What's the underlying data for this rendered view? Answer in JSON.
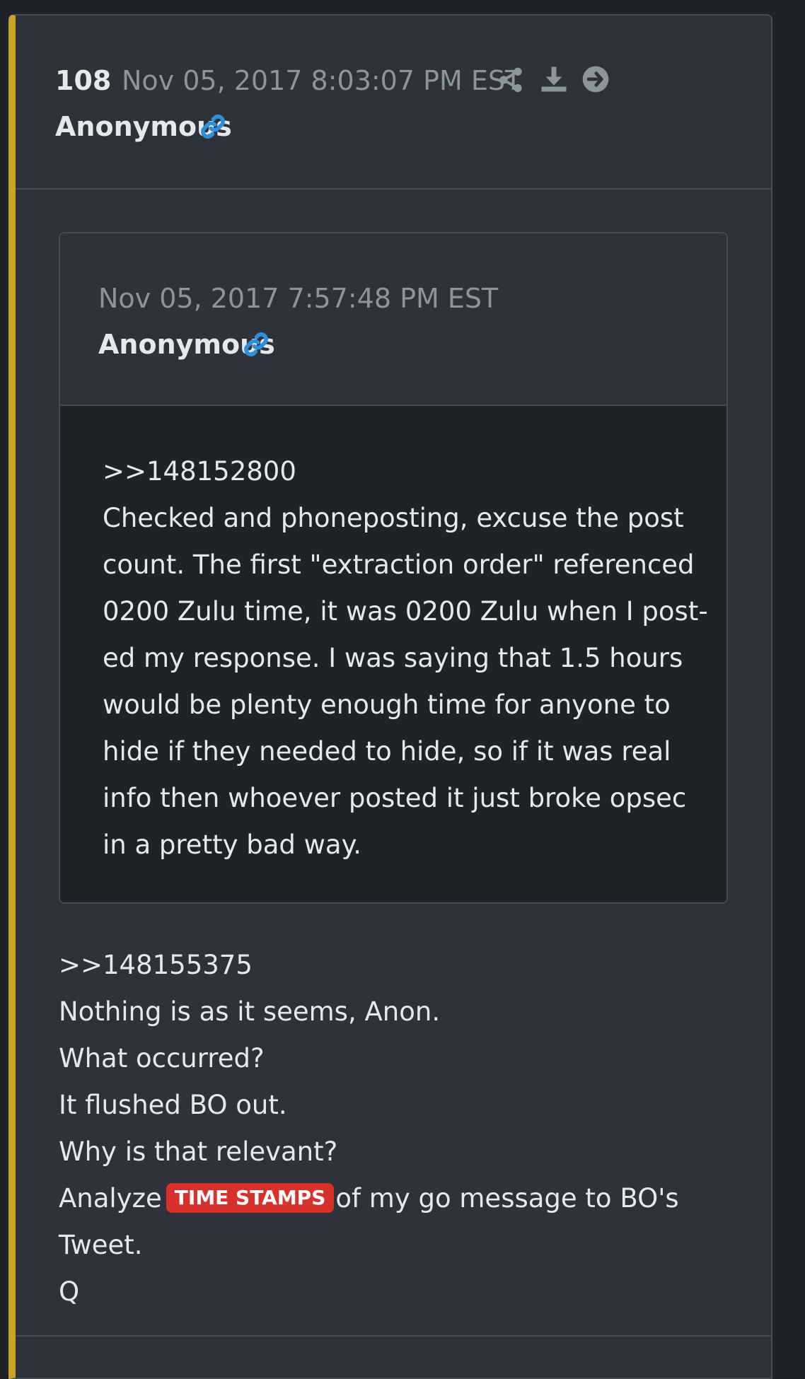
{
  "post": {
    "number": "108",
    "date": "Nov 05, 2017 8:03:07 PM EST",
    "author": "Anonymous",
    "actions": [
      "share-icon",
      "download-icon",
      "arrow-right-circle-icon"
    ]
  },
  "quoted_post": {
    "date": "Nov 05, 2017 7:57:48 PM EST",
    "author": "Anonymous",
    "lines": [
      ">>148152800",
      "Checked and phoneposting, excuse the post",
      "count. The first \"extraction order\" referenced",
      "0200 Zulu time, it was 0200 Zulu when I post-",
      "ed my response. I was saying that 1.5 hours",
      "would be plenty enough time for anyone to",
      "hide if they needed to hide, so if it was real",
      "info then whoever posted it just broke opsec",
      "in a pretty bad way."
    ]
  },
  "message": {
    "lines": [
      ">>148155375",
      "Nothing is as it seems, Anon.",
      "What occurred?",
      "It flushed BO out.",
      "Why is that relevant?"
    ],
    "highlight_line": {
      "before": "Analyze",
      "badge": "TIME STAMPS",
      "after": "of my go message to BO's"
    },
    "tail_lines": [
      "Tweet.",
      "Q"
    ]
  },
  "colors": {
    "accent_bar": "#c9a227",
    "link_icon": "#2f8fd8",
    "badge": "#d6312c"
  }
}
